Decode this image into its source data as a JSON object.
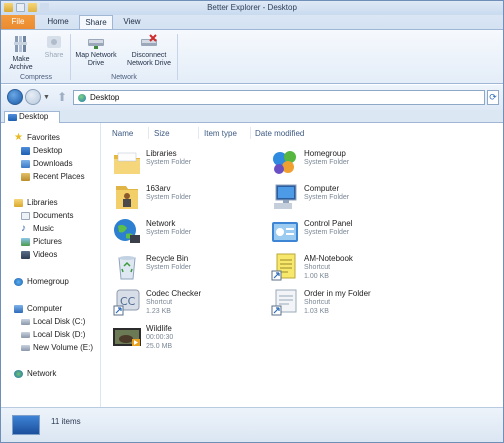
{
  "window": {
    "title": "Better Explorer - Desktop"
  },
  "ribbon": {
    "tabs": [
      "File",
      "Home",
      "Share",
      "View"
    ],
    "active_tab": "Share",
    "compress_group": {
      "label": "Compress",
      "make_archive": "Make Archive",
      "share": "Share"
    },
    "network_group": {
      "label": "Network",
      "map_drive": "Map Network Drive",
      "disconnect_drive": "Disconnect Network Drive"
    }
  },
  "address": {
    "path": "Desktop"
  },
  "tabs": {
    "current": "Desktop"
  },
  "sidebar": {
    "favorites": {
      "label": "Favorites",
      "items": [
        "Desktop",
        "Downloads",
        "Recent Places"
      ]
    },
    "libraries": {
      "label": "Libraries",
      "items": [
        "Documents",
        "Music",
        "Pictures",
        "Videos"
      ]
    },
    "homegroup": "Homegroup",
    "computer": {
      "label": "Computer",
      "items": [
        "Local Disk (C:)",
        "Local Disk (D:)",
        "New Volume (E:)"
      ]
    },
    "network": "Network"
  },
  "columns": [
    "Name",
    "Size",
    "Item type",
    "Date modified"
  ],
  "files": [
    {
      "name": "Libraries",
      "type": "System Folder",
      "size": "",
      "icon": "libraries-icon"
    },
    {
      "name": "Homegroup",
      "type": "System Folder",
      "size": "",
      "icon": "homegroup-icon"
    },
    {
      "name": "163arv",
      "type": "System Folder",
      "size": "",
      "icon": "user-folder-icon"
    },
    {
      "name": "Computer",
      "type": "System Folder",
      "size": "",
      "icon": "computer-icon"
    },
    {
      "name": "Network",
      "type": "System Folder",
      "size": "",
      "icon": "network-icon"
    },
    {
      "name": "Control Panel",
      "type": "System Folder",
      "size": "",
      "icon": "control-panel-icon"
    },
    {
      "name": "Recycle Bin",
      "type": "System Folder",
      "size": "",
      "icon": "recycle-bin-icon"
    },
    {
      "name": "AM-Notebook",
      "type": "Shortcut",
      "size": "1.00 KB",
      "icon": "notebook-shortcut-icon"
    },
    {
      "name": "Codec Checker",
      "type": "Shortcut",
      "size": "1.23 KB",
      "icon": "codec-checker-icon"
    },
    {
      "name": "Order in my Folder",
      "type": "Shortcut",
      "size": "1.03 KB",
      "icon": "order-folder-shortcut-icon"
    },
    {
      "name": "Wildlife",
      "type": "00:00:30",
      "size": "25.0 MB",
      "icon": "video-thumbnail-icon"
    }
  ],
  "status": {
    "item_count": "11 items"
  },
  "colors": {
    "file_tab": "#e2761c",
    "accent": "#1f5fb0",
    "ribbon": "#e4edf8"
  }
}
